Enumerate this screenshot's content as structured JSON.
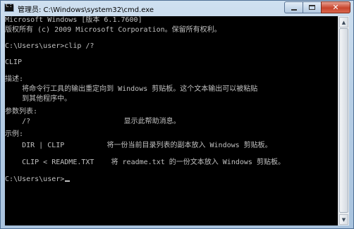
{
  "window": {
    "title": "管理员: C:\\Windows\\system32\\cmd.exe"
  },
  "console": {
    "lines": [
      "Microsoft Windows [版本 6.1.7600]",
      "版权所有 (c) 2009 Microsoft Corporation。保留所有权利。",
      "C:\\Users\\user>clip /?",
      "CLIP",
      "描述:",
      "    将命令行工具的输出重定向到 Windows 剪贴板。这个文本输出可以被粘贴",
      "    到其他程序中。",
      "参数列表:",
      "    /?                      显示此帮助消息。",
      "示例:",
      "    DIR | CLIP          将一份当前目录列表的副本放入 Windows 剪贴板。",
      "    CLIP < README.TXT    将 readme.txt 的一份文本放入 Windows 剪贴板。",
      "C:\\Users\\user>"
    ]
  },
  "icons": {
    "app": "cmd-icon",
    "minimize": "minimize-icon",
    "maximize": "maximize-icon",
    "close": "close-icon"
  },
  "colors": {
    "console_bg": "#000000",
    "console_text": "#c0c0c0",
    "close_button": "#c8452d"
  }
}
